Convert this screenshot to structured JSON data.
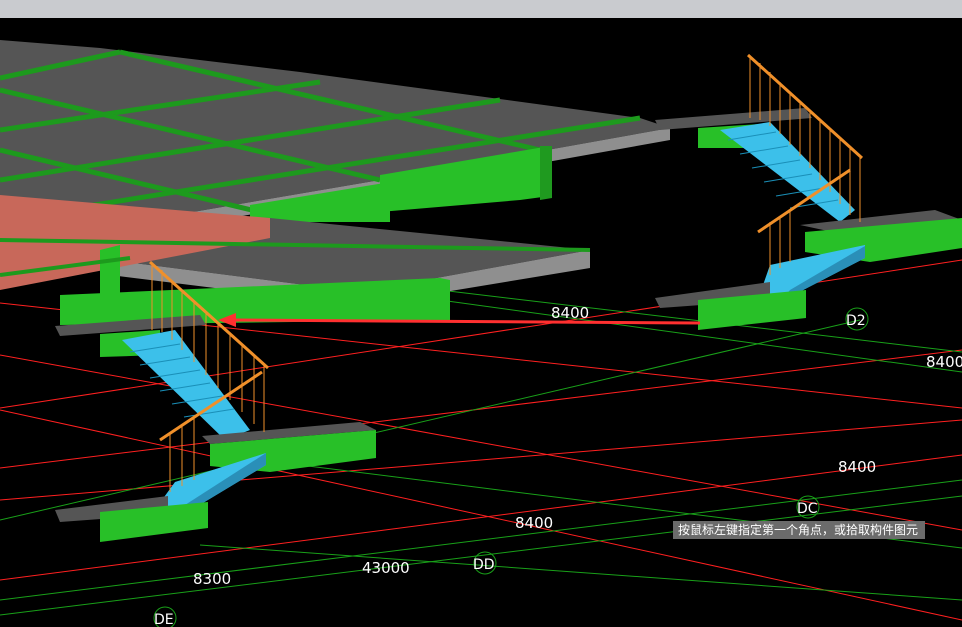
{
  "toolbar": {
    "background": "#c9cbcf"
  },
  "colors": {
    "background": "#000000",
    "slab_top": "#555555",
    "slab_edge": "#8f8f8f",
    "beam_green": "#28c028",
    "grid_red": "#ff2020",
    "grid_green": "#19a019",
    "stair_blue": "#3cc0ea",
    "railing_orange": "#f0902a",
    "selection_arrow": "#ff3030",
    "highlight_slab": "#c8685a"
  },
  "dimensions": {
    "d1": "8400",
    "d2": "8400",
    "d3": "8400",
    "d4": "8400",
    "d5": "8300",
    "d6": "43000"
  },
  "axes": {
    "a1": "D2",
    "a2": "DC",
    "a3": "DD",
    "a4": "DE"
  },
  "status": {
    "prompt": "按鼠标左键指定第一个角点，或拾取构件图元"
  }
}
